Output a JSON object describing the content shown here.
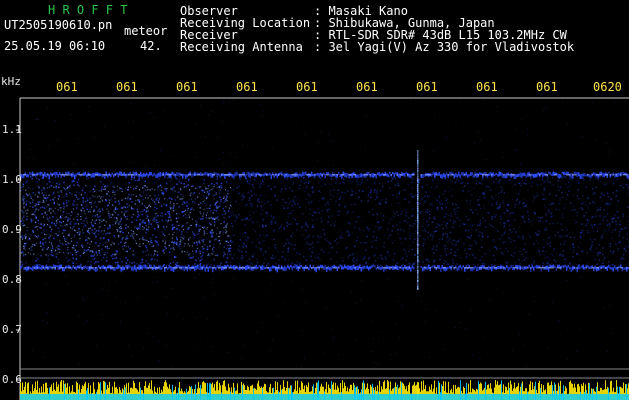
{
  "header": {
    "program": "H R O F F T",
    "filename": "UT2505190610.pn",
    "mode": "meteor",
    "datetime": "25.05.19 06:10",
    "count": "42.",
    "labels": [
      "Observer",
      "Receiving Location",
      "Receiver",
      "Receiving Antenna"
    ],
    "values": [
      ": Masaki Kano",
      ": Shibukawa, Gunma, Japan",
      ": RTL-SDR SDR# 43dB L15 103.2MHz CW",
      ": 3el Yagi(V) Az 330 for Vladivostok"
    ]
  },
  "freq_axis": {
    "unit": "kHz",
    "ticks": [
      "1.1",
      "1.0",
      "0.9",
      "0.8",
      "0.7",
      "0.6"
    ]
  },
  "time_axis": {
    "ticks": [
      "061",
      "061",
      "061",
      "061",
      "061",
      "061",
      "061",
      "061",
      "061",
      "0620"
    ]
  },
  "colors": {
    "background": "#000000",
    "header_green": "#26c64a",
    "tick_yellow": "#ffe14a",
    "signal_blue": "#2d4cff",
    "noise_bar": "#ffea00",
    "noise_bar2": "#00ccff"
  }
}
